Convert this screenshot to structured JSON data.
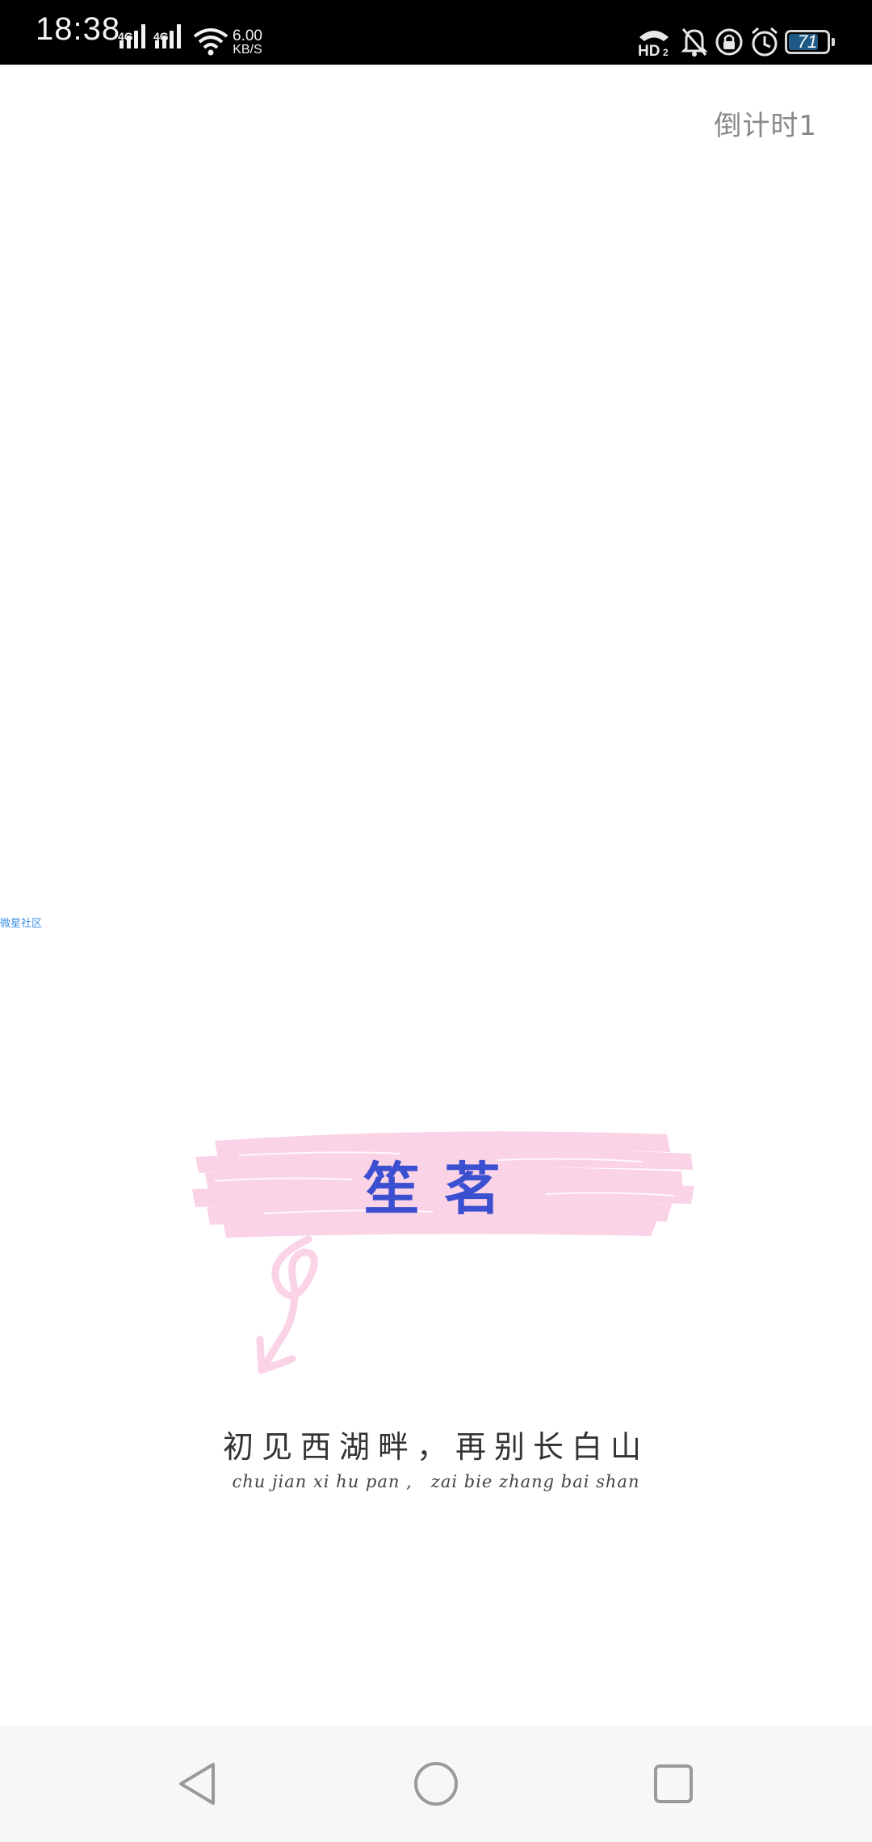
{
  "status_bar": {
    "time": "18:38",
    "network_1": "4G",
    "network_2": "4G",
    "speed_value": "6.00",
    "speed_unit": "KB/S",
    "battery_level": "71",
    "icons": [
      "signal-icon",
      "signal-icon",
      "wifi-icon",
      "hd-call-icon",
      "bell-off-icon",
      "rotation-lock-icon",
      "alarm-icon",
      "battery-icon"
    ]
  },
  "countdown": {
    "label": "倒计时1"
  },
  "small_link": {
    "text": "微星社区"
  },
  "splash": {
    "title": "笙茗",
    "slogan_cn": "初见西湖畔，再别长白山",
    "slogan_pinyin": "chu jian xi hu pan ,   zai bie zhang bai shan",
    "accent_color": "#3b4fd1",
    "brush_color": "#fbd3e6"
  },
  "nav_bar": {
    "buttons": [
      "back-icon",
      "home-icon",
      "recents-icon"
    ]
  }
}
